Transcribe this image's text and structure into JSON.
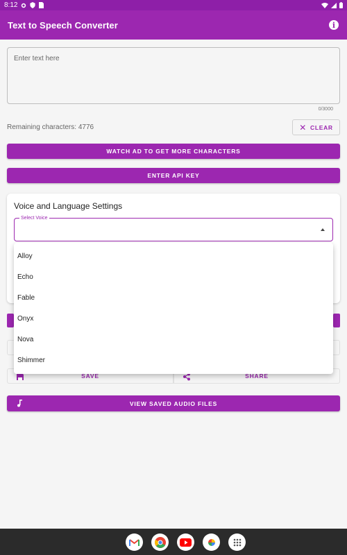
{
  "status_bar": {
    "time": "8:12",
    "icons": [
      "settings-icon",
      "shield-icon",
      "sim-icon",
      "wifi-icon",
      "signal-icon",
      "battery-icon"
    ]
  },
  "app_bar": {
    "title": "Text to Speech Converter",
    "info_icon": "info-icon",
    "color": "#9c27b0"
  },
  "text_input": {
    "placeholder": "Enter text here",
    "value": "",
    "counter": "0/3000"
  },
  "remaining_text": "Remaining characters: 4776",
  "clear_button": {
    "label": "CLEAR",
    "icon": "close-icon"
  },
  "watch_ad_button": {
    "label": "WATCH AD TO GET MORE CHARACTERS"
  },
  "api_key_button": {
    "label": "ENTER API KEY"
  },
  "voice_settings": {
    "title": "Voice and Language Settings",
    "select_label": "Select Voice",
    "selected_value": "",
    "options": [
      "Alloy",
      "Echo",
      "Fable",
      "Onyx",
      "Nova",
      "Shimmer"
    ]
  },
  "save_button": {
    "label": "SAVE",
    "icon": "save-icon"
  },
  "share_button": {
    "label": "SHARE",
    "icon": "share-icon"
  },
  "view_saved_button": {
    "label": "VIEW SAVED AUDIO FILES",
    "icon": "music-note-icon"
  },
  "dock_apps": [
    "gmail-icon",
    "chrome-icon",
    "youtube-icon",
    "photos-icon",
    "app-drawer-icon"
  ]
}
